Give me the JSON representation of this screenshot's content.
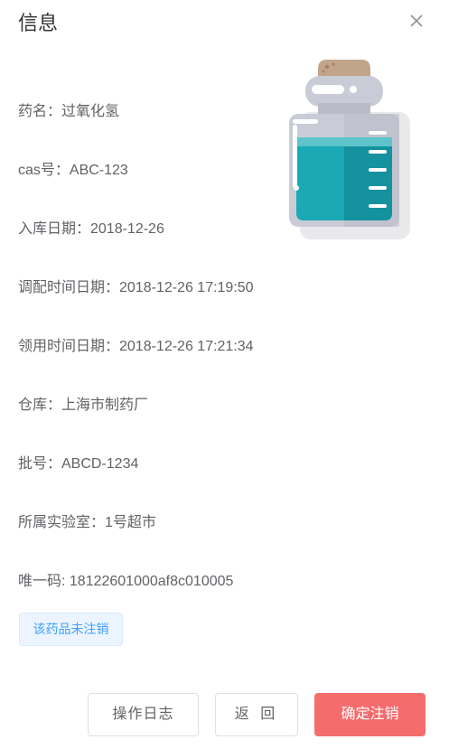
{
  "dialog": {
    "title": "信息"
  },
  "fields": [
    {
      "text": "药名：过氧化氢"
    },
    {
      "text": "cas号：ABC-123"
    },
    {
      "text": "入库日期：2018-12-26"
    },
    {
      "text": "调配时间日期：2018-12-26 17:19:50"
    },
    {
      "text": "领用时间日期：2018-12-26 17:21:34"
    },
    {
      "text": "仓库：上海市制药厂"
    },
    {
      "text": "批号：ABCD-1234"
    },
    {
      "text": "所属实验室：1号超市"
    },
    {
      "text": "唯一码: 18122601000af8c010005"
    }
  ],
  "status_tag": "该药品未注销",
  "buttons": {
    "log": "操作日志",
    "back": "返 回",
    "confirm": "确定注销"
  },
  "icons": {
    "close": "close-icon",
    "bottle": "chemical-bottle-illustration"
  },
  "colors": {
    "primary": "#409eff",
    "danger": "#f56c6c",
    "liquid": "#1aa9b5"
  }
}
